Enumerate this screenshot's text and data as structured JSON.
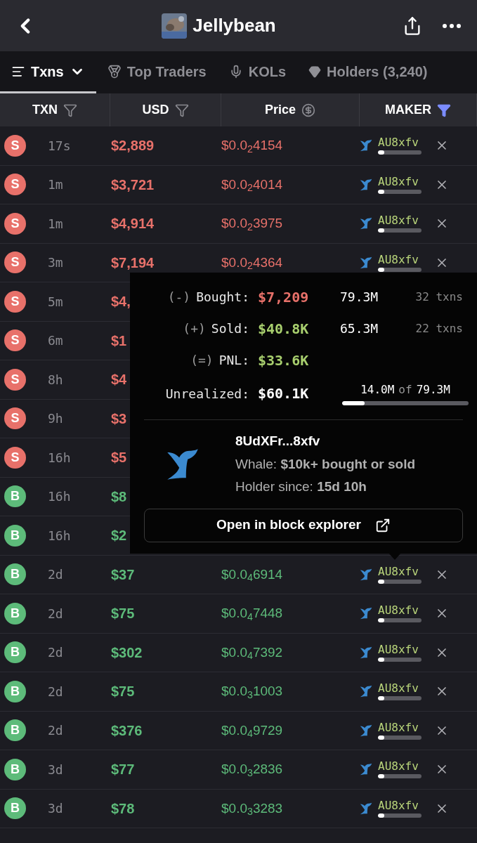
{
  "header": {
    "title": "Jellybean"
  },
  "tabs": [
    {
      "label": "Txns",
      "selected": true,
      "kind": "menu"
    },
    {
      "label": "Top Traders",
      "selected": false,
      "kind": "medal"
    },
    {
      "label": "KOLs",
      "selected": false,
      "kind": "mic"
    },
    {
      "label": "Holders (3,240)",
      "selected": false,
      "kind": "gem"
    }
  ],
  "columns": [
    {
      "label": "TXN",
      "kind": "filter",
      "active": false
    },
    {
      "label": "USD",
      "kind": "filter",
      "active": false
    },
    {
      "label": "Price",
      "kind": "dollar",
      "active": false
    },
    {
      "label": "MAKER",
      "kind": "filter",
      "active": true
    }
  ],
  "rows": [
    {
      "kind": "sell",
      "badge": "S",
      "time": "17s",
      "usd": "$2,889",
      "price": "$0.0$_{2}$4154",
      "maker": "AU8xfv",
      "level": 0.15
    },
    {
      "kind": "sell",
      "badge": "S",
      "time": "1m",
      "usd": "$3,721",
      "price": "$0.0$_{2}$4014",
      "maker": "AU8xfv",
      "level": 0.15
    },
    {
      "kind": "sell",
      "badge": "S",
      "time": "1m",
      "usd": "$4,914",
      "price": "$0.0$_{2}$3975",
      "maker": "AU8xfv",
      "level": 0.15
    },
    {
      "kind": "sell",
      "badge": "S",
      "time": "3m",
      "usd": "$7,194",
      "price": "$0.0$_{2}$4364",
      "maker": "AU8xfv",
      "level": 0.15
    },
    {
      "kind": "sell",
      "badge": "S",
      "time": "5m",
      "usd": "$4,"
    },
    {
      "kind": "sell",
      "badge": "S",
      "time": "6m",
      "usd": "$1"
    },
    {
      "kind": "sell",
      "badge": "S",
      "time": "8h",
      "usd": "$4"
    },
    {
      "kind": "sell",
      "badge": "S",
      "time": "9h",
      "usd": "$3"
    },
    {
      "kind": "sell",
      "badge": "S",
      "time": "16h",
      "usd": "$5"
    },
    {
      "kind": "buy",
      "badge": "B",
      "time": "16h",
      "usd": "$8"
    },
    {
      "kind": "buy",
      "badge": "B",
      "time": "16h",
      "usd": "$2"
    },
    {
      "kind": "buy",
      "badge": "B",
      "time": "2d",
      "usd": "$37",
      "price": "$0.0$_{4}$6914",
      "maker": "AU8xfv",
      "level": 0.15
    },
    {
      "kind": "buy",
      "badge": "B",
      "time": "2d",
      "usd": "$75",
      "price": "$0.0$_{4}$7448",
      "maker": "AU8xfv",
      "level": 0.15
    },
    {
      "kind": "buy",
      "badge": "B",
      "time": "2d",
      "usd": "$302",
      "price": "$0.0$_{4}$7392",
      "maker": "AU8xfv",
      "level": 0.15
    },
    {
      "kind": "buy",
      "badge": "B",
      "time": "2d",
      "usd": "$75",
      "price": "$0.0$_{3}$1003",
      "maker": "AU8xfv",
      "level": 0.15
    },
    {
      "kind": "buy",
      "badge": "B",
      "time": "2d",
      "usd": "$376",
      "price": "$0.0$_{4}$9729",
      "maker": "AU8xfv",
      "level": 0.15
    },
    {
      "kind": "buy",
      "badge": "B",
      "time": "3d",
      "usd": "$77",
      "price": "$0.0$_{3}$2836",
      "maker": "AU8xfv",
      "level": 0.15
    },
    {
      "kind": "buy",
      "badge": "B",
      "time": "3d",
      "usd": "$78",
      "price": "$0.0$_{3}$3283",
      "maker": "AU8xfv",
      "level": 0.15
    }
  ],
  "popup": {
    "stats": [
      {
        "sign": "(-)",
        "label": "Bought:",
        "value": "$7,209",
        "kind": "loss",
        "amount": "79.3M",
        "txns": "32 txns"
      },
      {
        "sign": "(+)",
        "label": "Sold:",
        "value": "$40.8K",
        "kind": "gain",
        "amount": "65.3M",
        "txns": "22 txns"
      },
      {
        "sign": "(=)",
        "label": "PNL:",
        "value": "$33.6K",
        "kind": "gain"
      }
    ],
    "unrealized": {
      "label": "Unrealized:",
      "value": "$60.1K",
      "held": "14.0M",
      "of": "of",
      "total": "79.3M",
      "level": 0.18
    },
    "address": "8UdXFr...8xfv",
    "whale": "Whale: **$10k+ bought or sold**",
    "holder_since": "Holder since: **15d 10h**",
    "button": "Open in block explorer"
  }
}
